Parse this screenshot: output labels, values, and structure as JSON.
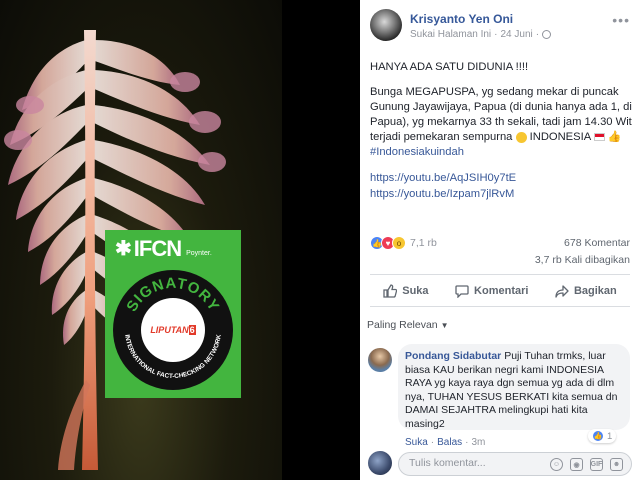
{
  "post": {
    "author": "Krisyanto Yen Oni",
    "page_action": "Sukai Halaman Ini",
    "separator": "·",
    "date": "24 Juni",
    "privacy_icon": "globe-icon",
    "more_icon": "more-options-icon",
    "headline": "HANYA ADA SATU DIDUNIA !!!!",
    "body": "Bunga MEGAPUSPA, yg sedang mekar di puncak Gunung Jayawijaya, Papua (di dunia hanya ada 1, di Papua), yg mekarnya 33 th sekali, tadi jam 14.30 Wit terjadi pemekaran sempurna",
    "body_country": "INDONESIA",
    "hashtag": "#Indonesiakuindah",
    "links": [
      "https://youtu.be/AqJSIH0y7tE",
      "https://youtu.be/Izpam7jlRvM"
    ]
  },
  "stats": {
    "reactions_count": "7,1 rb",
    "comments_count": "678 Komentar",
    "shares_count": "3,7 rb Kali dibagikan"
  },
  "actions": {
    "like": "Suka",
    "comment": "Komentari",
    "share": "Bagikan"
  },
  "comments": {
    "filter_label": "Paling Relevan",
    "top": {
      "author": "Pondang Sidabutar",
      "text": "Puji Tuhan trmks, luar biasa KAU berikan negri kami INDONESIA RAYA yg kaya raya dgn semua yg ada di dlm nya, TUHAN YESUS BERKATI kita semua dn DAMAI SEJAHTRA melingkupi hati kita masing2",
      "reaction_count": "1",
      "like_link": "Suka",
      "reply_link": "Balas",
      "separator": "·",
      "time": "3m"
    },
    "write_placeholder": "Tulis komentar..."
  },
  "badge": {
    "brand": "IFCN",
    "partner": "Poynter.",
    "ring_top": "SIGNATORY",
    "ring_bottom": "INTERNATIONAL FACT-CHECKING NETWORK",
    "logo_text": "LIPUTAN",
    "logo_number": "6"
  },
  "colors": {
    "link": "#385898",
    "author": "#365899",
    "badge_green": "#43b53f",
    "like_reaction": "#4c84f5",
    "love_reaction": "#ee3b55"
  }
}
